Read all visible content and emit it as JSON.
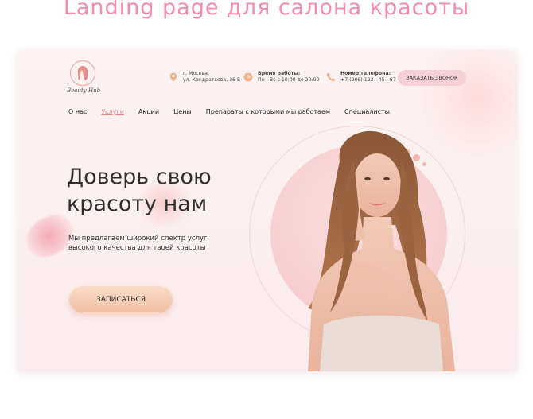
{
  "showcase_title": "Landing page для салона красоты",
  "logo": {
    "text": "Beauty Hub",
    "icon": "hair-silhouette-icon"
  },
  "header": {
    "address": {
      "icon": "location-pin-icon",
      "line1": "г. Москва,",
      "line2": "ул. Кондратьева, 36 Б"
    },
    "hours": {
      "icon": "clock-icon",
      "label": "Время работы:",
      "value": "Пн - Вс с 10:00 до 20:00"
    },
    "phone": {
      "icon": "phone-icon",
      "label": "Номер телефона:",
      "value": "+7 (906) 123 - 45 - 67"
    },
    "call_button": "ЗАКАЗАТЬ ЗВОНОК"
  },
  "nav": {
    "items": [
      "О нас",
      "Услуги",
      "Акции",
      "Цены",
      "Препараты с которыми мы работаем",
      "Специалисты"
    ],
    "active": "Услуги"
  },
  "hero": {
    "title_line1": "Доверь свою",
    "title_line2": "красоту нам",
    "subtitle_line1": "Мы предлагаем широкий спектр услуг",
    "subtitle_line2": "высокого качества для твоей красоты",
    "cta_label": "ЗАПИСАТЬСЯ"
  },
  "colors": {
    "accent": "#e8838d",
    "title_pink": "#f08db0",
    "button_peach": "#f3c0a4",
    "call_button": "#f7cfd6"
  }
}
